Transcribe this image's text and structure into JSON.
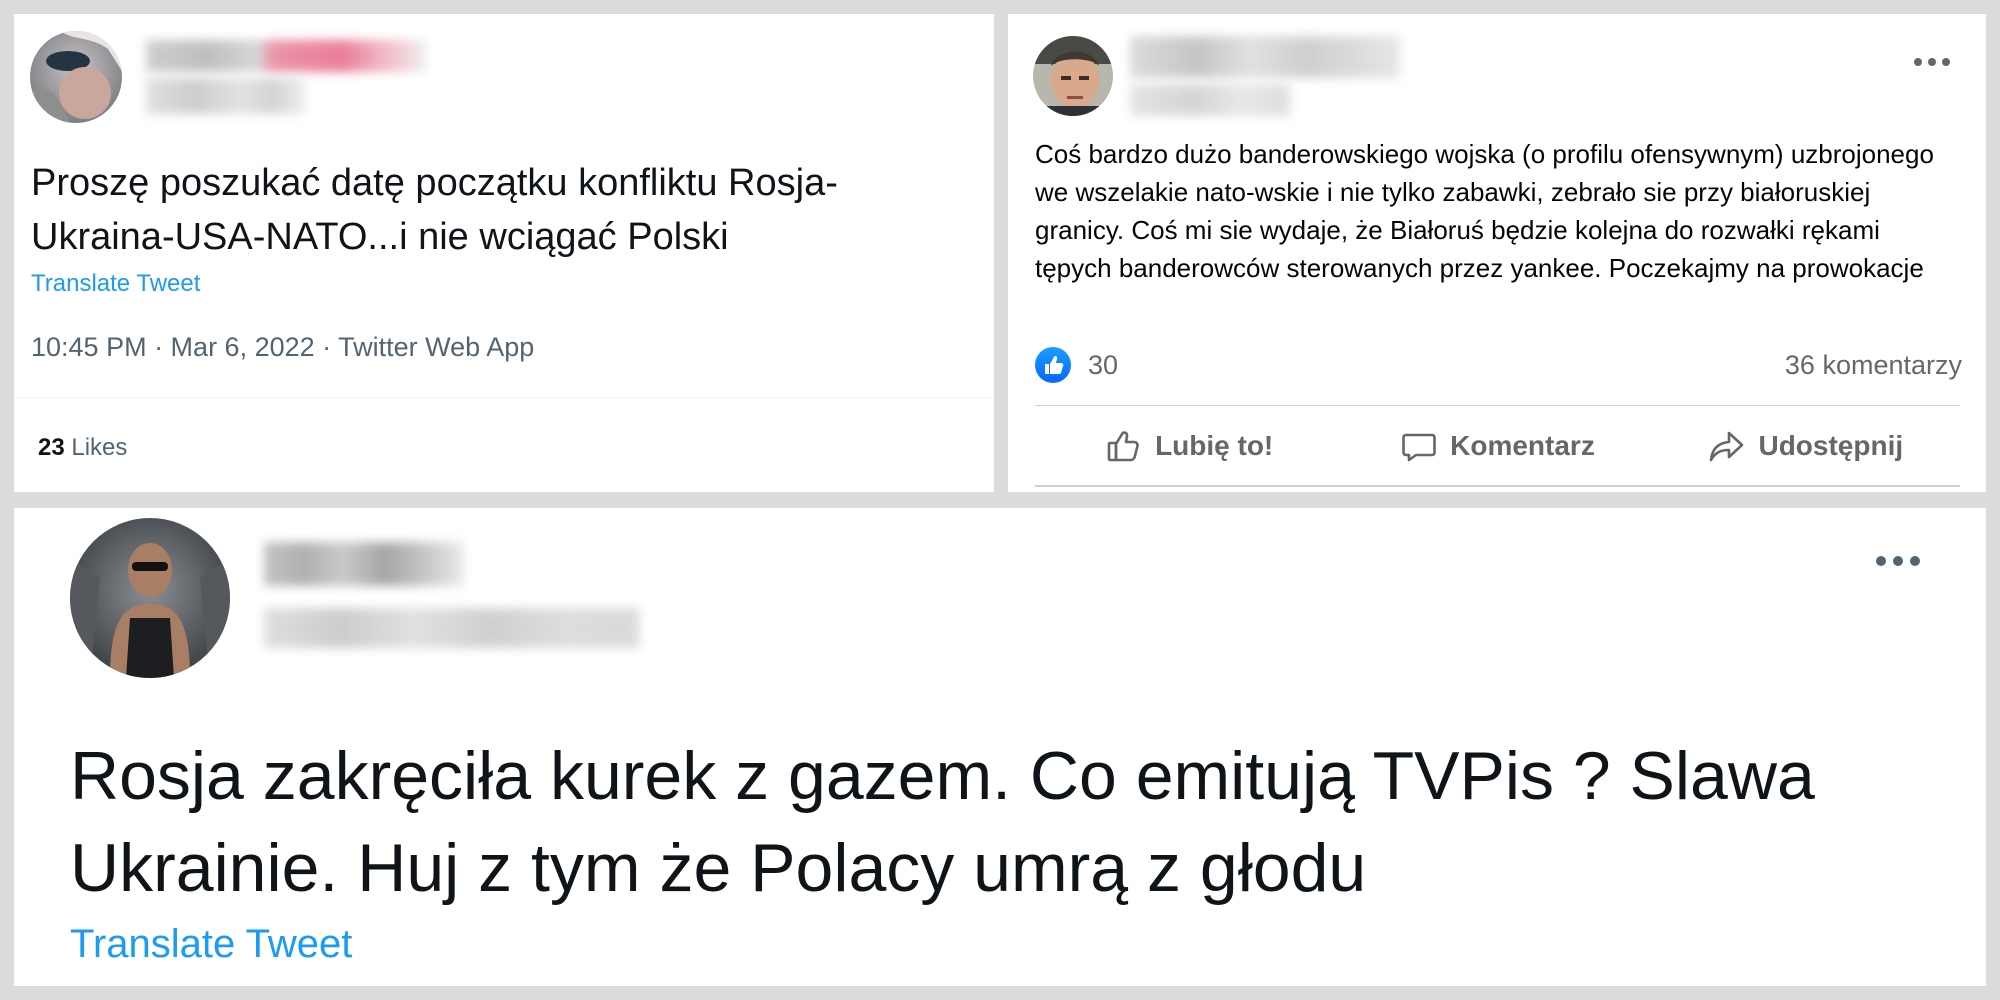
{
  "tweet_top": {
    "text": "Proszę poszukać datę początku konfliktu Rosja-Ukraina-USA-NATO...i nie wciągać Polski",
    "translate_label": "Translate Tweet",
    "meta": "10:45 PM · Mar 6, 2022 · Twitter Web App",
    "likes_count": "23",
    "likes_label": "Likes"
  },
  "facebook_post": {
    "text": "Coś bardzo dużo banderowskiego wojska (o profilu ofensywnym) uzbrojonego we wszelakie nato-wskie i nie tylko zabawki, zebrało sie przy białoruskiej granicy. Coś mi sie wydaje, że Białoruś będzie kolejna do rozwałki rękami tępych banderowców sterowanych przez yankee. Poczekajmy na prowokacje",
    "reaction_count": "30",
    "comments_label": "36 komentarzy",
    "actions": {
      "like": "Lubię to!",
      "comment": "Komentarz",
      "share": "Udostępnij"
    }
  },
  "tweet_bottom": {
    "text": "Rosja zakręciła kurek z gazem. Co emitują TVPis ? Slawa Ukrainie. Huj z tym że Polacy umrą z głodu",
    "translate_label": "Translate Tweet"
  },
  "colors": {
    "twitter_blue": "#1d9bf0",
    "facebook_blue": "#0866ff",
    "secondary_text": "#536471"
  }
}
